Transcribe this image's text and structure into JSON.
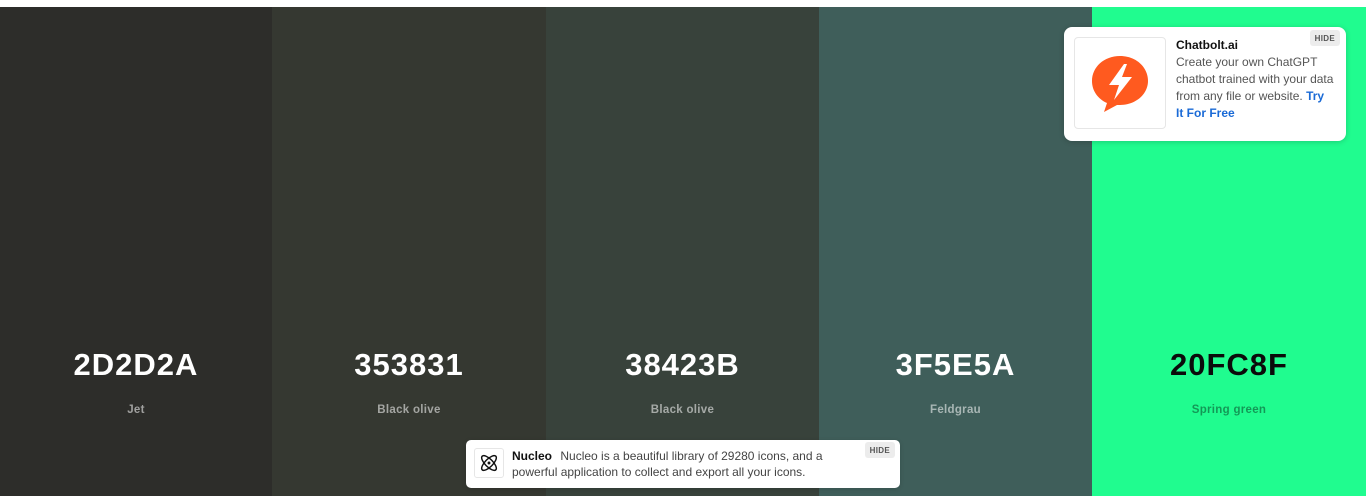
{
  "palette": {
    "colors": [
      {
        "hex": "2D2D2A",
        "name": "Jet",
        "color": "#2D2D2A",
        "theme": "dark"
      },
      {
        "hex": "353831",
        "name": "Black olive",
        "color": "#353831",
        "theme": "dark"
      },
      {
        "hex": "38423B",
        "name": "Black olive",
        "color": "#38423B",
        "theme": "dark"
      },
      {
        "hex": "3F5E5A",
        "name": "Feldgrau",
        "color": "#3F5E5A",
        "theme": "dark"
      },
      {
        "hex": "20FC8F",
        "name": "Spring green",
        "color": "#20FC8F",
        "theme": "light"
      }
    ]
  },
  "ad": {
    "title": "Chatbolt.ai",
    "description": "Create your own ChatGPT chatbot trained with your data from any file or website.",
    "link_label": "Try It For Free",
    "hide_label": "HIDE",
    "icon": "chatbolt-logo-icon",
    "accent": "#FF5A1F"
  },
  "nucleo": {
    "title": "Nucleo",
    "description": "Nucleo is a beautiful library of 29280 icons, and a powerful application to collect and export all your icons.",
    "hide_label": "HIDE",
    "icon": "nucleo-atom-icon"
  }
}
